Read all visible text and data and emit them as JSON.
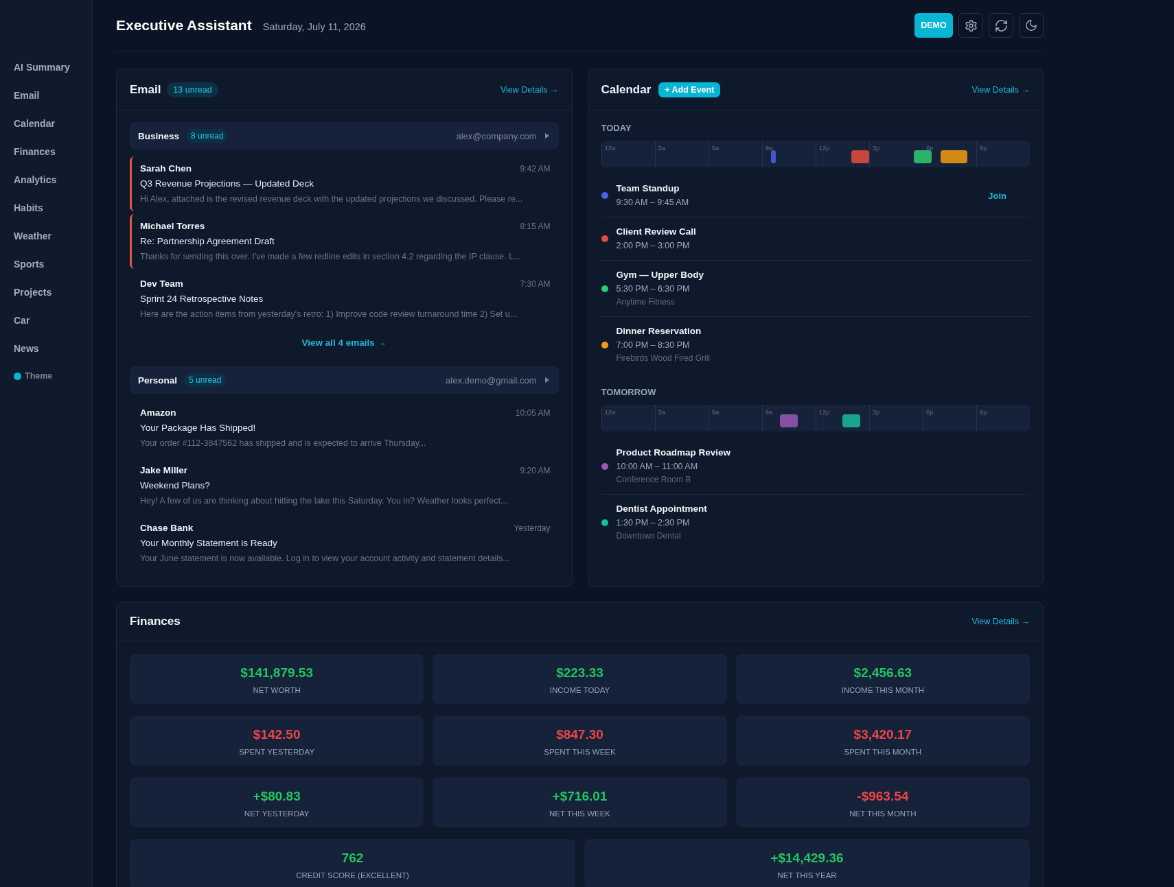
{
  "sidebar": {
    "items": [
      {
        "label": "AI Summary"
      },
      {
        "label": "Email"
      },
      {
        "label": "Calendar"
      },
      {
        "label": "Finances"
      },
      {
        "label": "Analytics"
      },
      {
        "label": "Habits"
      },
      {
        "label": "Weather"
      },
      {
        "label": "Sports"
      },
      {
        "label": "Projects"
      },
      {
        "label": "Car"
      },
      {
        "label": "News"
      }
    ],
    "theme": {
      "label": "Theme"
    }
  },
  "header": {
    "title": "Executive Assistant",
    "date": "Saturday, July 11, 2026",
    "demo_button": "DEMO"
  },
  "email": {
    "title": "Email",
    "badge": "13 unread",
    "view_details": "View Details →",
    "groups": [
      {
        "name": "Business",
        "badge": "8 unread",
        "address": "alex@company.com",
        "messages": [
          {
            "sender": "Sarah Chen",
            "time": "9:42 AM",
            "subject": "Q3 Revenue Projections — Updated Deck",
            "preview": "Hi Alex, attached is the revised revenue deck with the updated projections we discussed. Please re...",
            "flagged": true
          },
          {
            "sender": "Michael Torres",
            "time": "8:15 AM",
            "subject": "Re: Partnership Agreement Draft",
            "preview": "Thanks for sending this over. I've made a few redline edits in section 4.2 regarding the IP clause. L...",
            "flagged": true
          },
          {
            "sender": "Dev Team",
            "time": "7:30 AM",
            "subject": "Sprint 24 Retrospective Notes",
            "preview": "Here are the action items from yesterday's retro: 1) Improve code review turnaround time 2) Set u...",
            "flagged": false
          }
        ],
        "view_all": "View all 4 emails →"
      },
      {
        "name": "Personal",
        "badge": "5 unread",
        "address": "alex.demo@gmail.com",
        "messages": [
          {
            "sender": "Amazon",
            "time": "10:05 AM",
            "subject": "Your Package Has Shipped!",
            "preview": "Your order #112-3847562 has shipped and is expected to arrive Thursday...",
            "flagged": false
          },
          {
            "sender": "Jake Miller",
            "time": "9:20 AM",
            "subject": "Weekend Plans?",
            "preview": "Hey! A few of us are thinking about hitting the lake this Saturday. You in? Weather looks perfect...",
            "flagged": false
          },
          {
            "sender": "Chase Bank",
            "time": "Yesterday",
            "subject": "Your Monthly Statement is Ready",
            "preview": "Your June statement is now available. Log in to view your account activity and statement details...",
            "flagged": false
          }
        ]
      }
    ]
  },
  "calendar": {
    "title": "Calendar",
    "add_button": "+ Add Event",
    "view_details": "View Details →",
    "days": [
      {
        "label": "TODAY",
        "hours": [
          "12a",
          "3a",
          "6a",
          "9a",
          "12p",
          "3p",
          "6p",
          "9p"
        ],
        "events": [
          {
            "title": "Team Standup",
            "time": "9:30 AM – 9:45 AM",
            "color": "#4a62e8",
            "action": "Join"
          },
          {
            "title": "Client Review Call",
            "time": "2:00 PM – 3:00 PM",
            "color": "#e74c3c"
          },
          {
            "title": "Gym — Upper Body",
            "time": "5:30 PM – 6:30 PM",
            "location": "Anytime Fitness",
            "color": "#2ecc71"
          },
          {
            "title": "Dinner Reservation",
            "time": "7:00 PM – 8:30 PM",
            "location": "Firebirds Wood Fired Grill",
            "color": "#f39c12"
          }
        ]
      },
      {
        "label": "TOMORROW",
        "hours": [
          "12a",
          "3a",
          "6a",
          "9a",
          "12p",
          "3p",
          "6p",
          "9p"
        ],
        "events": [
          {
            "title": "Product Roadmap Review",
            "time": "10:00 AM – 11:00 AM",
            "location": "Conference Room B",
            "color": "#9b59b6"
          },
          {
            "title": "Dentist Appointment",
            "time": "1:30 PM – 2:30 PM",
            "location": "Downtown Dental",
            "color": "#1abc9c"
          }
        ]
      }
    ]
  },
  "finances": {
    "title": "Finances",
    "view_details": "View Details →",
    "rows": [
      {
        "cards": [
          {
            "value": "$141,879.53",
            "label": "NET WORTH",
            "negative": false
          },
          {
            "value": "$223.33",
            "label": "INCOME TODAY",
            "negative": false
          },
          {
            "value": "$2,456.63",
            "label": "INCOME THIS MONTH",
            "negative": false
          }
        ]
      },
      {
        "cards": [
          {
            "value": "$142.50",
            "label": "SPENT YESTERDAY",
            "negative": true
          },
          {
            "value": "$847.30",
            "label": "SPENT THIS WEEK",
            "negative": true
          },
          {
            "value": "$3,420.17",
            "label": "SPENT THIS MONTH",
            "negative": true
          }
        ]
      },
      {
        "cards": [
          {
            "value": "+$80.83",
            "label": "NET YESTERDAY",
            "negative": false
          },
          {
            "value": "+$716.01",
            "label": "NET THIS WEEK",
            "negative": false
          },
          {
            "value": "-$963.54",
            "label": "NET THIS MONTH",
            "negative": true
          }
        ]
      },
      {
        "cards": [
          {
            "value": "762",
            "label": "CREDIT SCORE (EXCELLENT)",
            "negative": false
          },
          {
            "value": "+$14,429.36",
            "label": "NET THIS YEAR",
            "negative": false
          }
        ]
      }
    ]
  }
}
